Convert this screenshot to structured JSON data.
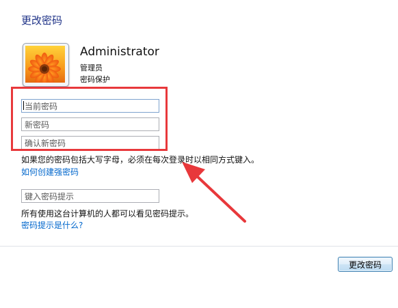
{
  "page": {
    "title": "更改密码"
  },
  "user": {
    "name": "Administrator",
    "role": "管理员",
    "status": "密码保护",
    "avatar_icon": "flower-icon"
  },
  "form": {
    "current_password_placeholder": "当前密码",
    "new_password_placeholder": "新密码",
    "confirm_password_placeholder": "确认新密码",
    "case_note": "如果您的密码包括大写字母，必须在每次登录时以相同方式键入。",
    "strong_password_link": "如何创建强密码",
    "hint_placeholder": "键入密码提示",
    "hint_note": "所有使用这台计算机的人都可以看见密码提示。",
    "hint_help_link": "密码提示是什么?"
  },
  "actions": {
    "submit_label": "更改密码"
  },
  "colors": {
    "title": "#1e3287",
    "link": "#0066cc",
    "annotation": "#e8383b"
  }
}
